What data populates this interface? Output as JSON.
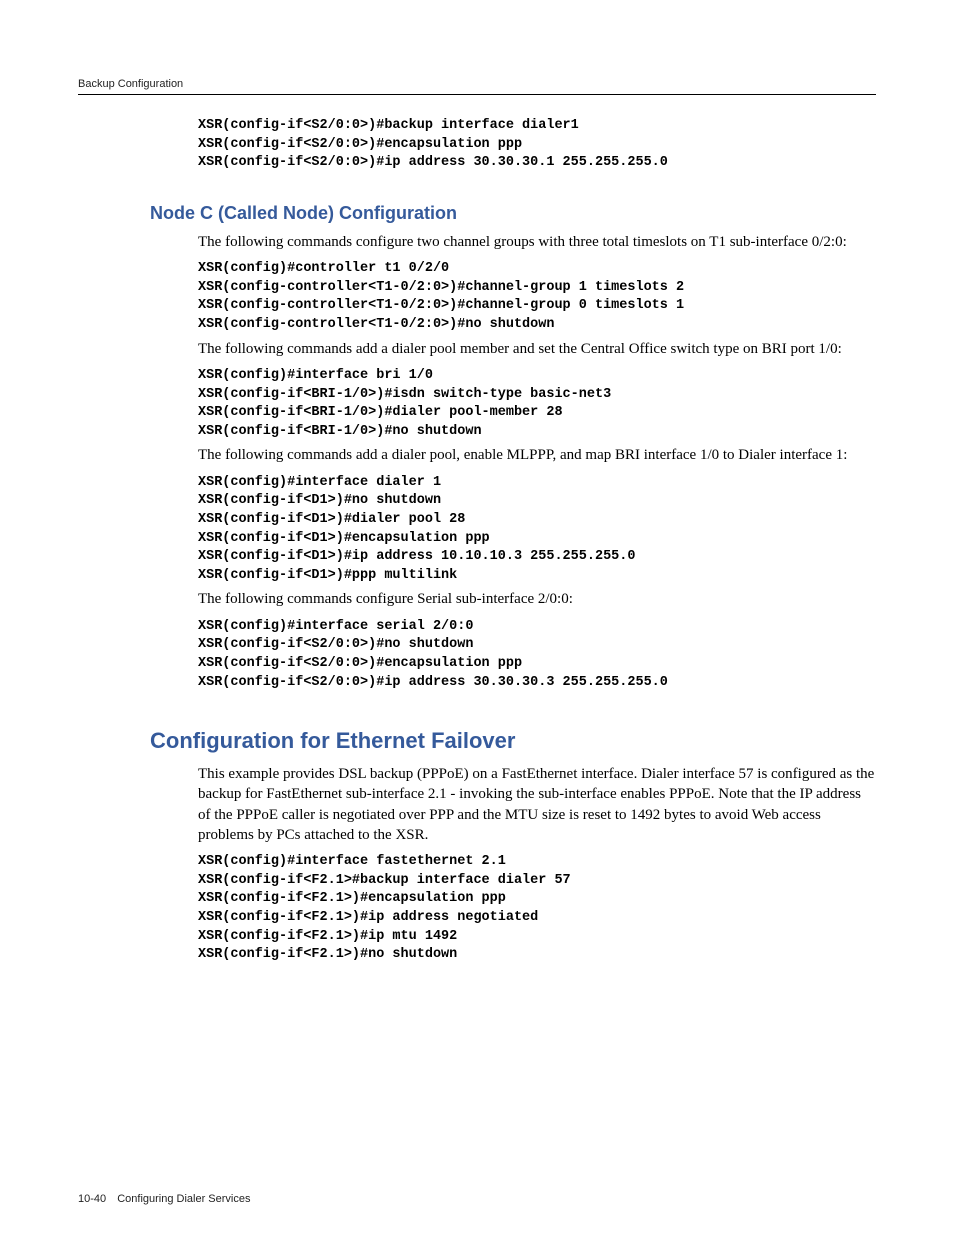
{
  "header": {
    "running": "Backup Configuration"
  },
  "footer": {
    "page": "10-40",
    "title": "Configuring Dialer Services"
  },
  "blocks": {
    "code0": "XSR(config-if<S2/0:0>)#backup interface dialer1\nXSR(config-if<S2/0:0>)#encapsulation ppp\nXSR(config-if<S2/0:0>)#ip address 30.30.30.1 255.255.255.0",
    "h2_nodec": "Node C (Called Node) Configuration",
    "p1": "The following commands configure two channel groups with three total timeslots on T1 sub-interface 0/2:0:",
    "code1": "XSR(config)#controller t1 0/2/0\nXSR(config-controller<T1-0/2:0>)#channel-group 1 timeslots 2\nXSR(config-controller<T1-0/2:0>)#channel-group 0 timeslots 1\nXSR(config-controller<T1-0/2:0>)#no shutdown",
    "p2": "The following commands add a dialer pool member and set the Central Office switch type on BRI port 1/0:",
    "code2": "XSR(config)#interface bri 1/0\nXSR(config-if<BRI-1/0>)#isdn switch-type basic-net3\nXSR(config-if<BRI-1/0>)#dialer pool-member 28\nXSR(config-if<BRI-1/0>)#no shutdown",
    "p3": "The following commands add a dialer pool, enable MLPPP, and map BRI interface 1/0 to Dialer interface 1:",
    "code3": "XSR(config)#interface dialer 1\nXSR(config-if<D1>)#no shutdown\nXSR(config-if<D1>)#dialer pool 28\nXSR(config-if<D1>)#encapsulation ppp\nXSR(config-if<D1>)#ip address 10.10.10.3 255.255.255.0\nXSR(config-if<D1>)#ppp multilink",
    "p4": "The following commands configure Serial sub-interface 2/0:0:",
    "code4": "XSR(config)#interface serial 2/0:0\nXSR(config-if<S2/0:0>)#no shutdown\nXSR(config-if<S2/0:0>)#encapsulation ppp\nXSR(config-if<S2/0:0>)#ip address 30.30.30.3 255.255.255.0",
    "h1_failover": "Configuration for Ethernet Failover",
    "p5": "This example provides DSL backup (PPPoE) on a FastEthernet interface. Dialer interface 57 is configured as the backup for FastEthernet sub-interface 2.1 - invoking the sub-interface enables PPPoE. Note that the IP address of the PPPoE caller is negotiated over PPP and the MTU size is reset to 1492 bytes to avoid Web access problems by PCs attached to the XSR.",
    "code5": "XSR(config)#interface fastethernet 2.1\nXSR(config-if<F2.1>#backup interface dialer 57\nXSR(config-if<F2.1>)#encapsulation ppp\nXSR(config-if<F2.1>)#ip address negotiated\nXSR(config-if<F2.1>)#ip mtu 1492\nXSR(config-if<F2.1>)#no shutdown"
  }
}
